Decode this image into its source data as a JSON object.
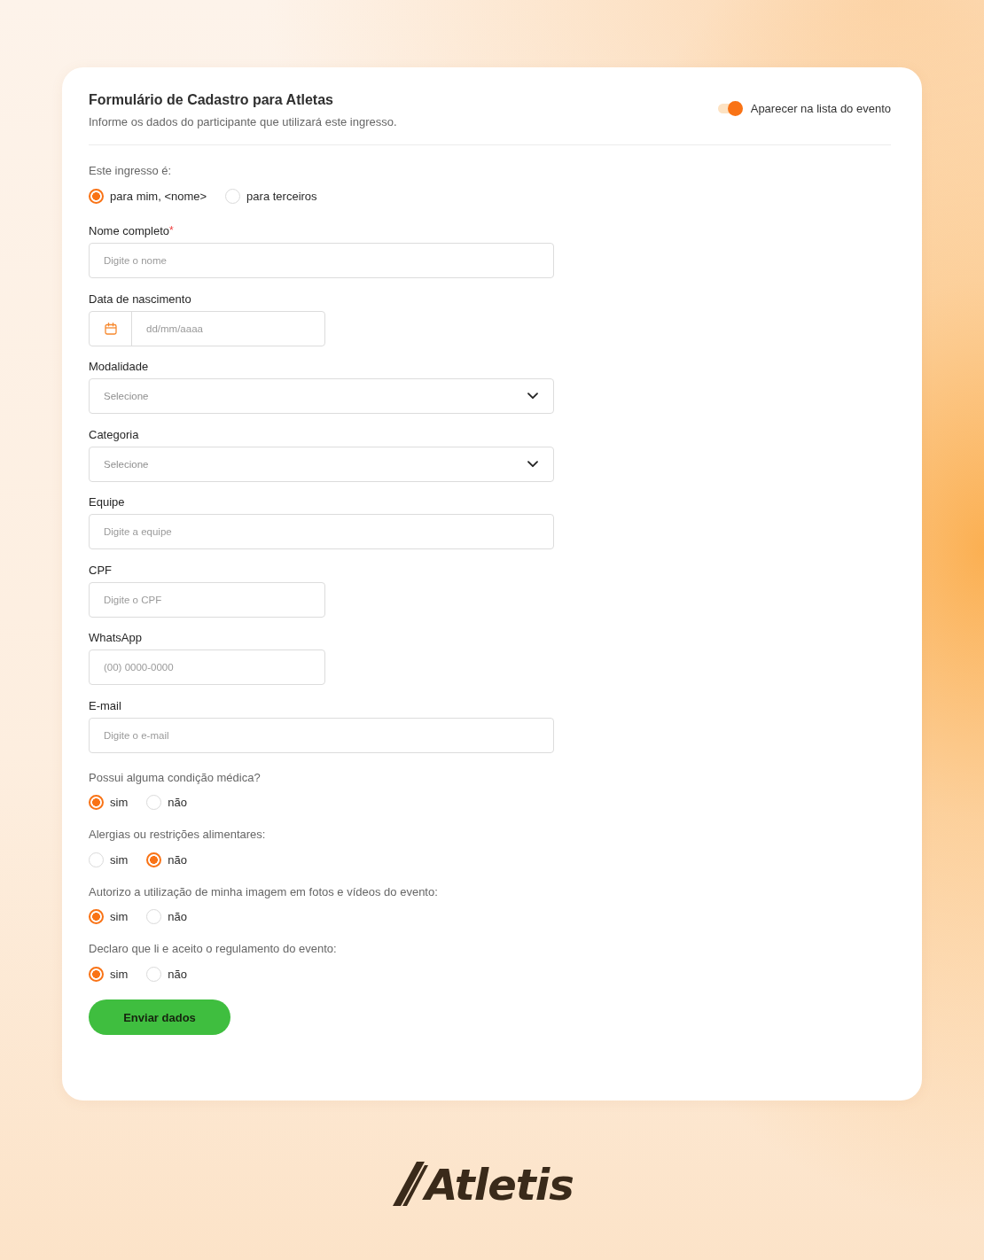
{
  "header": {
    "title": "Formulário de Cadastro para Atletas",
    "subtitle": "Informe os dados do participante que utilizará este ingresso."
  },
  "list_toggle": {
    "label": "Aparecer na lista do evento",
    "on": true
  },
  "ticket_for": {
    "label": "Este ingresso é:",
    "options": [
      {
        "label": "para mim, <nome>",
        "selected": true
      },
      {
        "label": "para terceiros",
        "selected": false
      }
    ]
  },
  "fields": [
    {
      "kind": "text",
      "label": "Nome completo",
      "required_mark": "*",
      "placeholder": "Digite o nome"
    },
    {
      "kind": "date",
      "label": "Data de nascimento",
      "placeholder": "dd/mm/aaaa"
    },
    {
      "kind": "select",
      "label": "Modalidade",
      "placeholder": "Selecione"
    },
    {
      "kind": "select",
      "label": "Categoria",
      "placeholder": "Selecione"
    },
    {
      "kind": "text",
      "label": "Equipe",
      "placeholder": "Digite a equipe"
    },
    {
      "kind": "short_text",
      "label": "CPF",
      "placeholder": "Digite o CPF"
    },
    {
      "kind": "short_text",
      "label": "WhatsApp",
      "placeholder": "(00) 0000-0000"
    },
    {
      "kind": "text",
      "label": "E-mail",
      "placeholder": "Digite o e-mail"
    }
  ],
  "questions": [
    {
      "label": "Possui alguma condição médica?",
      "options": [
        {
          "label": "sim",
          "selected": true
        },
        {
          "label": "não",
          "selected": false
        }
      ]
    },
    {
      "label": "Alergias ou restrições alimentares:",
      "options": [
        {
          "label": "sim",
          "selected": false
        },
        {
          "label": "não",
          "selected": true
        }
      ]
    },
    {
      "label": "Autorizo a utilização de minha imagem em fotos e vídeos do evento:",
      "options": [
        {
          "label": "sim",
          "selected": true
        },
        {
          "label": "não",
          "selected": false
        }
      ]
    },
    {
      "label": "Declaro que li e aceito o regulamento do evento:",
      "options": [
        {
          "label": "sim",
          "selected": true
        },
        {
          "label": "não",
          "selected": false
        }
      ]
    }
  ],
  "submit_button": {
    "label": "Enviar dados"
  },
  "logo": {
    "text": "Atletis"
  }
}
